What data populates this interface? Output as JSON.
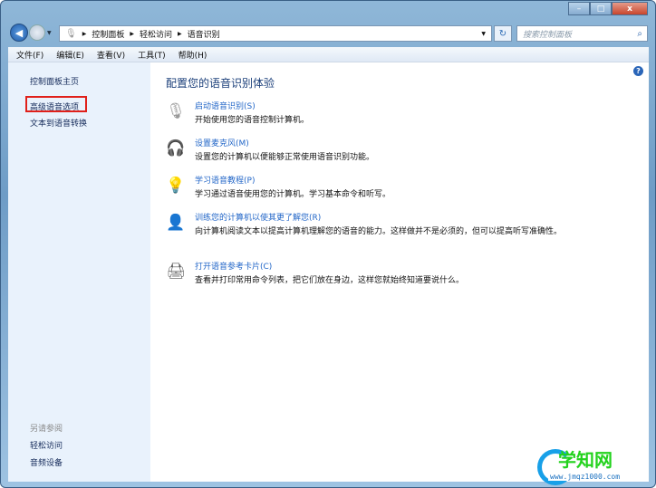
{
  "window": {
    "buttons": {
      "minimize": "–",
      "maximize": "□",
      "close": "x"
    }
  },
  "address": {
    "crumbs": [
      "控制面板",
      "轻松访问",
      "语音识别"
    ]
  },
  "search": {
    "placeholder": "搜索控制面板"
  },
  "menu": [
    "文件(F)",
    "编辑(E)",
    "查看(V)",
    "工具(T)",
    "帮助(H)"
  ],
  "sidebar": {
    "items": [
      "控制面板主页",
      "高级语音选项",
      "文本到语音转换"
    ],
    "see_also": "另请参阅",
    "see_also_items": [
      "轻松访问",
      "音频设备"
    ]
  },
  "main": {
    "heading": "配置您的语音识别体验",
    "items": [
      {
        "icon": "microphone-icon",
        "link": "启动语音识别(S)",
        "desc": "开始使用您的语音控制计算机。"
      },
      {
        "icon": "headset-icon",
        "link": "设置麦克风(M)",
        "desc": "设置您的计算机以便能够正常使用语音识别功能。"
      },
      {
        "icon": "lightbulb-icon",
        "link": "学习语音教程(P)",
        "desc": "学习通过语音使用您的计算机。学习基本命令和听写。"
      },
      {
        "icon": "user-icon",
        "link": "训练您的计算机以使其更了解您(R)",
        "desc": "向计算机阅读文本以提高计算机理解您的语音的能力。这样做并不是必须的，但可以提高听写准确性。"
      },
      {
        "icon": "printer-icon",
        "link": "打开语音参考卡片(C)",
        "desc": "查看并打印常用命令列表，把它们放在身边，这样您就始终知道要说什么。"
      }
    ]
  },
  "watermark": {
    "title": "学知网",
    "url": "www.jmqz1000.com"
  }
}
